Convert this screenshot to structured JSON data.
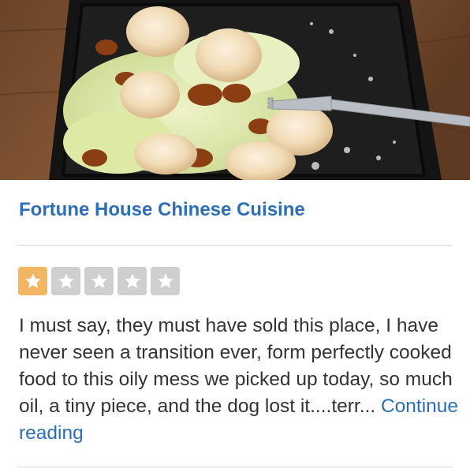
{
  "business": {
    "name": "Fortune House Chinese Cuisine"
  },
  "photo": {
    "subject": "fried-shrimp-with-walnuts-in-takeout-container"
  },
  "rating": {
    "value": 1,
    "max": 5,
    "icon": "star-icon",
    "filled_color": "#f2b562",
    "empty_color": "#cfcfcf"
  },
  "review": {
    "text": "I must say, they must have sold this place, I have never seen a transition ever, form perfectly cooked food to this oily mess we picked up today, so much oil, a tiny piece, and the dog lost it....terr... ",
    "continue_label": "Continue reading"
  },
  "colors": {
    "link": "#2d6fb7",
    "body_text": "#333333",
    "divider": "#d6d6d6"
  }
}
